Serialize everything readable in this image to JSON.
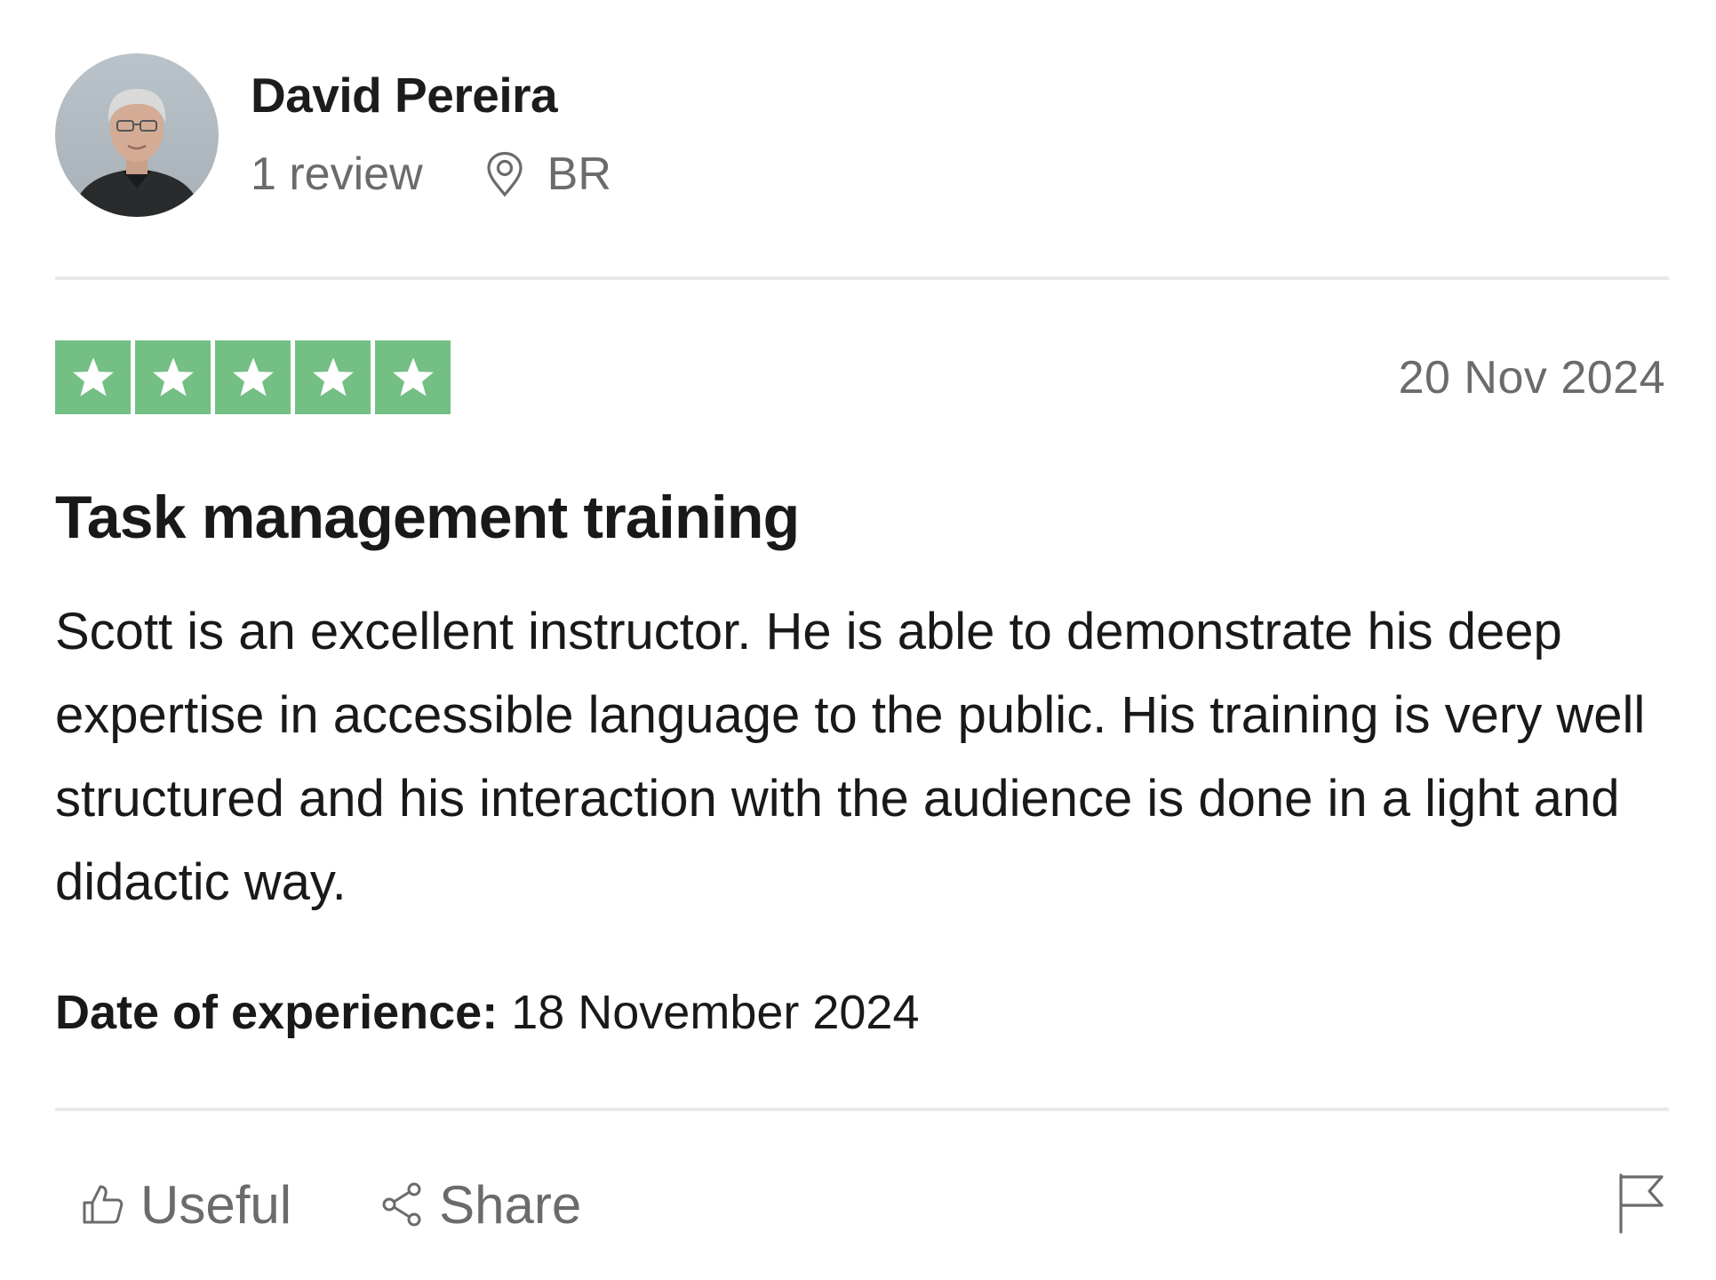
{
  "reviewer": {
    "name": "David Pereira",
    "review_count": "1 review",
    "country": "BR"
  },
  "review": {
    "rating": 5,
    "rating_max": 5,
    "date": "20 Nov 2024",
    "title": "Task management training",
    "body": "Scott is an excellent instructor. He is able to demonstrate his deep expertise in accessible language to the public. His training is very well structured and his interaction with the audience is done in a light and didactic way.",
    "experience_label": "Date of experience:",
    "experience_date": "18 November 2024"
  },
  "actions": {
    "useful_label": "Useful",
    "share_label": "Share"
  },
  "icons": {
    "location": "location-pin-icon",
    "useful": "thumbs-up-icon",
    "share": "share-icon",
    "report": "flag-icon",
    "star": "star-icon"
  },
  "colors": {
    "star_green": "#73bf84",
    "text_dark": "#191919",
    "text_muted": "#6b6b6b",
    "divider": "#e8e8e6"
  }
}
